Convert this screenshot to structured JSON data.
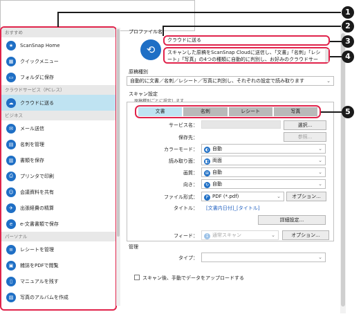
{
  "sidebar": {
    "sections": [
      {
        "title": "おすすめ",
        "items": [
          {
            "label": "ScanSnap Home",
            "icon": "scansnap-home-icon"
          },
          {
            "label": "クイックメニュー",
            "icon": "quick-menu-icon"
          },
          {
            "label": "フォルダに保存",
            "icon": "folder-icon"
          }
        ]
      },
      {
        "title": "クラウドサービス（PCレス）",
        "items": [
          {
            "label": "クラウドに送る",
            "icon": "cloud-send-icon"
          }
        ]
      },
      {
        "title": "ビジネス",
        "items": [
          {
            "label": "メール送信",
            "icon": "mail-icon"
          },
          {
            "label": "名刺を管理",
            "icon": "business-card-icon"
          },
          {
            "label": "書類を保存",
            "icon": "document-icon"
          },
          {
            "label": "プリンタで印刷",
            "icon": "printer-icon"
          },
          {
            "label": "会議資料を共有",
            "icon": "meeting-icon"
          },
          {
            "label": "出張経費の精算",
            "icon": "airplane-icon"
          },
          {
            "label": "e-文書書類で保存",
            "icon": "e-document-icon"
          }
        ]
      },
      {
        "title": "パーソナル",
        "items": [
          {
            "label": "レシートを管理",
            "icon": "receipt-icon"
          },
          {
            "label": "雑誌をPDFで閲覧",
            "icon": "magazine-icon"
          },
          {
            "label": "マニュアルを残す",
            "icon": "manual-icon"
          },
          {
            "label": "写真のアルバムを作成",
            "icon": "photo-album-icon"
          }
        ]
      }
    ]
  },
  "profile": {
    "label": "プロファイル名",
    "name": "クラウドに送る",
    "description": "スキャンした原稿をScanSnap Cloudに送信し、「文書」「名刺」「レシート」「写真」の4つの種類に自動的に判別し、お好みのクラウドサービ"
  },
  "detect": {
    "label": "原稿種別",
    "value": "自動的に文書／名刺／レシート／写真に判別し、それぞれの設定で読み取ります"
  },
  "scan": {
    "label": "スキャン設定",
    "sublabel": "原稿種別ごとに設定します",
    "tabs": [
      "文書",
      "名刺",
      "レシート",
      "写真"
    ],
    "service_label": "サービス名：",
    "service_value": "",
    "select_button": "選択...",
    "save_label": "保存先：",
    "browse_button": "参照...",
    "color_label": "カラーモード：",
    "color_value": "自動",
    "sides_label": "読み取り面：",
    "sides_value": "両面",
    "quality_label": "画質：",
    "quality_value": "自動",
    "orientation_label": "向き：",
    "orientation_value": "自動",
    "format_label": "ファイル形式：",
    "format_value": "PDF (*.pdf)",
    "option_button": "オプション...",
    "title_label": "タイトル：",
    "title_value": "[文書内日付]_[タイトル]",
    "detail_button": "詳細設定...",
    "feed_label": "フィード：",
    "feed_value": "通常スキャン",
    "feed_option_button": "オプション..."
  },
  "manage": {
    "label": "管理",
    "type_label": "タイプ：",
    "type_value": ""
  },
  "upload_checkbox": "スキャン後、手動でデータをアップロードする",
  "callouts": [
    "1",
    "2",
    "3",
    "4",
    "5"
  ],
  "colors": {
    "accent": "#e0224a",
    "brand": "#1f6fc5",
    "selected": "#bfe3f2"
  }
}
